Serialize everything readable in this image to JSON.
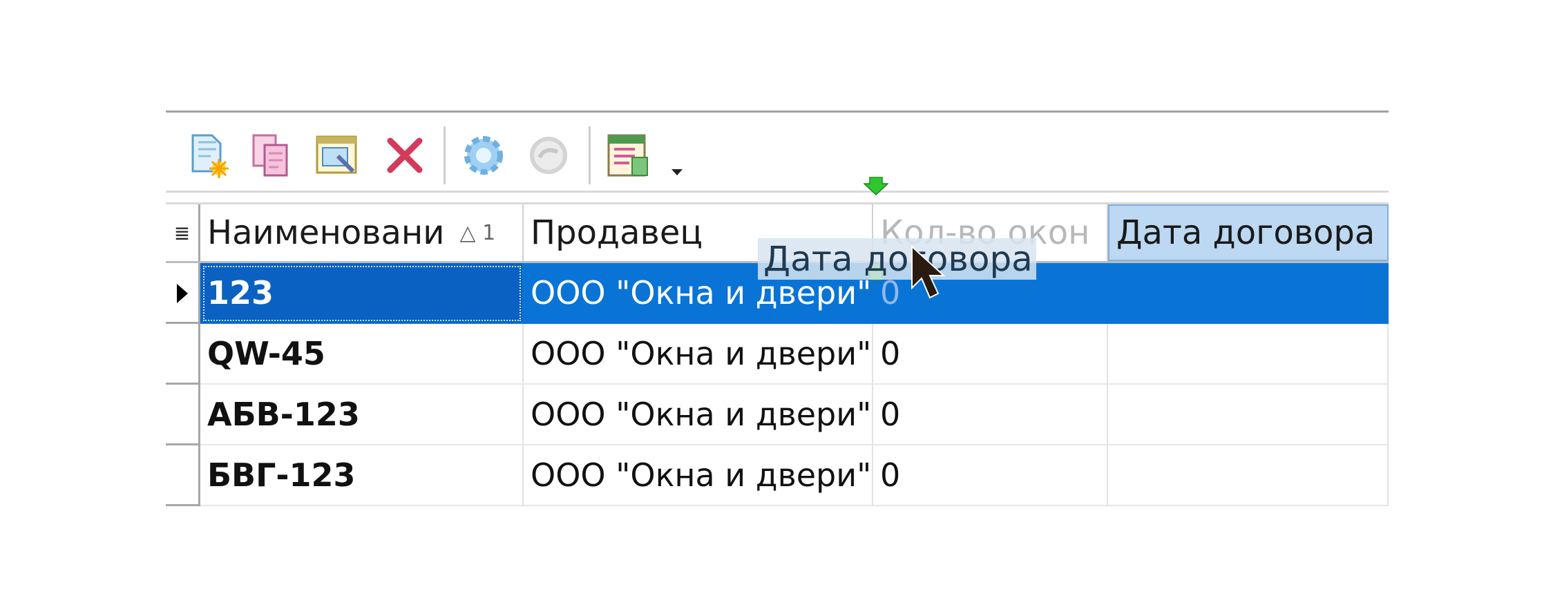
{
  "toolbar": {
    "buttons": [
      {
        "icon": "new-record-icon"
      },
      {
        "icon": "copy-record-icon"
      },
      {
        "icon": "edit-record-icon"
      },
      {
        "icon": "delete-icon"
      },
      {
        "icon": "refresh-icon"
      },
      {
        "icon": "undo-icon"
      },
      {
        "icon": "report-icon"
      }
    ]
  },
  "grid": {
    "columns": [
      {
        "label": "Наименовани",
        "sort": "△ 1"
      },
      {
        "label": "Продавец"
      },
      {
        "label": "Кол-во окон"
      },
      {
        "label": "Дата договора"
      }
    ],
    "rows": [
      {
        "name": "123",
        "seller": "ООО \"Окна и двери\"",
        "qty": "0",
        "date": ""
      },
      {
        "name": "QW-45",
        "seller": "ООО \"Окна и двери\"",
        "qty": "0",
        "date": ""
      },
      {
        "name": "АБВ-123",
        "seller": "ООО \"Окна и двери\"",
        "qty": "0",
        "date": ""
      },
      {
        "name": "БВГ-123",
        "seller": "ООО \"Окна и двери\"",
        "qty": "0",
        "date": ""
      }
    ],
    "drag_label": "Дата договора"
  },
  "colors": {
    "selection": "#0a74d6",
    "active_header": "#bcd8f2",
    "drop_marker": "#2fc62f"
  }
}
